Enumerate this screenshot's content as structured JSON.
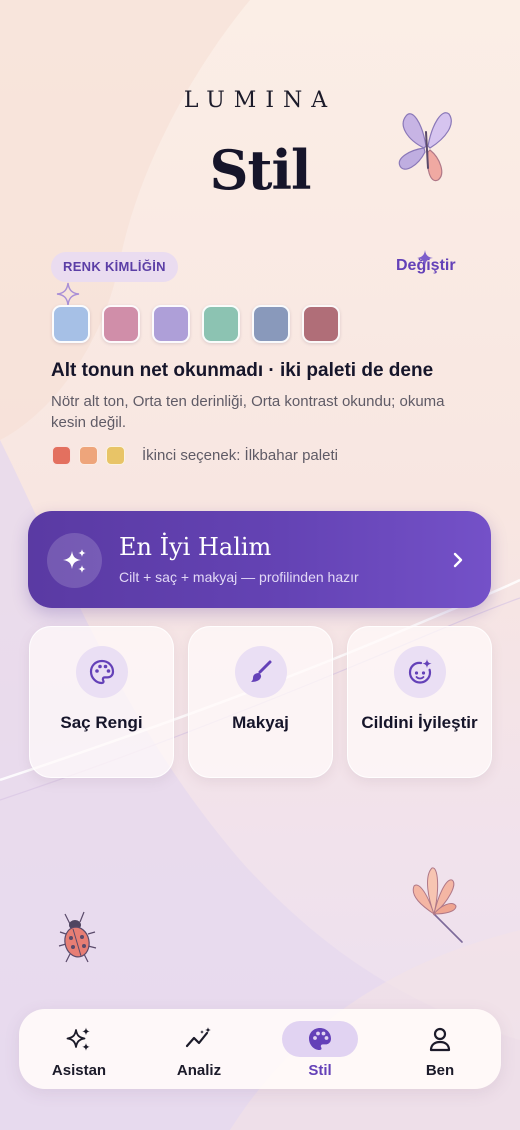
{
  "app": {
    "brand": "LUMINA",
    "page_title": "Stil"
  },
  "identity": {
    "chip_label": "RENK KİMLİĞİN",
    "change_label": "Değiştir",
    "swatch_colors": [
      "#a6c0e6",
      "#d08ea9",
      "#ae9fd8",
      "#8cc3b2",
      "#8999bb",
      "#b06e78"
    ],
    "palette_title": "Alt tonun net okunmadı · iki paleti de dene",
    "palette_description": "Nötr alt ton, Orta ten derinliği, Orta kontrast okundu; okuma kesin değil.",
    "alt_swatch_colors": [
      "#e3705f",
      "#eea57b",
      "#e8c467"
    ],
    "alt_text": "İkinci seçenek: İlkbahar paleti"
  },
  "hero": {
    "title": "En İyi Halim",
    "subtitle": "Cilt + saç + makyaj — profilinden hazır",
    "icon": "sparkles-icon"
  },
  "cards": [
    {
      "label": "Saç Rengi",
      "icon": "palette-icon"
    },
    {
      "label": "Makyaj",
      "icon": "brush-icon"
    },
    {
      "label": "Cildini İyileştir",
      "icon": "face-sparkle-icon"
    }
  ],
  "tabs": [
    {
      "label": "Asistan",
      "icon": "sparkles-icon",
      "active": false
    },
    {
      "label": "Analiz",
      "icon": "trend-icon",
      "active": false
    },
    {
      "label": "Stil",
      "icon": "palette-icon",
      "active": true
    },
    {
      "label": "Ben",
      "icon": "person-icon",
      "active": false
    }
  ],
  "colors": {
    "accent": "#6441b8",
    "hero_gradient_start": "#5a3aa3",
    "hero_gradient_end": "#7451c8",
    "active_tab_bg": "#e1d3f2"
  }
}
